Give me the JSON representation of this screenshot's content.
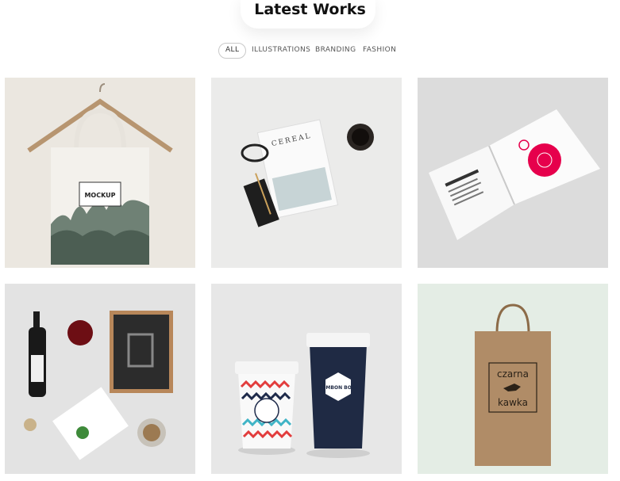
{
  "section": {
    "title": "Latest Works"
  },
  "filters": [
    {
      "label": "ALL",
      "active": true
    },
    {
      "label": "ILLUSTRATIONS",
      "active": false
    },
    {
      "label": "BRANDING",
      "active": false
    },
    {
      "label": "FASHION",
      "active": false
    }
  ],
  "works": [
    {
      "name": "tote-bag-mockup",
      "text": [
        "MOCKUP"
      ]
    },
    {
      "name": "cereal-magazine",
      "text": [
        "CEREAL"
      ]
    },
    {
      "name": "open-booklet"
    },
    {
      "name": "wine-branding"
    },
    {
      "name": "coffee-cups",
      "text": [
        "BOMBON BOSS"
      ]
    },
    {
      "name": "paper-bag",
      "text": [
        "czarna",
        "kawka"
      ]
    }
  ],
  "colors": {
    "accent": "#e6004c",
    "page_bg": "#ffffff"
  }
}
